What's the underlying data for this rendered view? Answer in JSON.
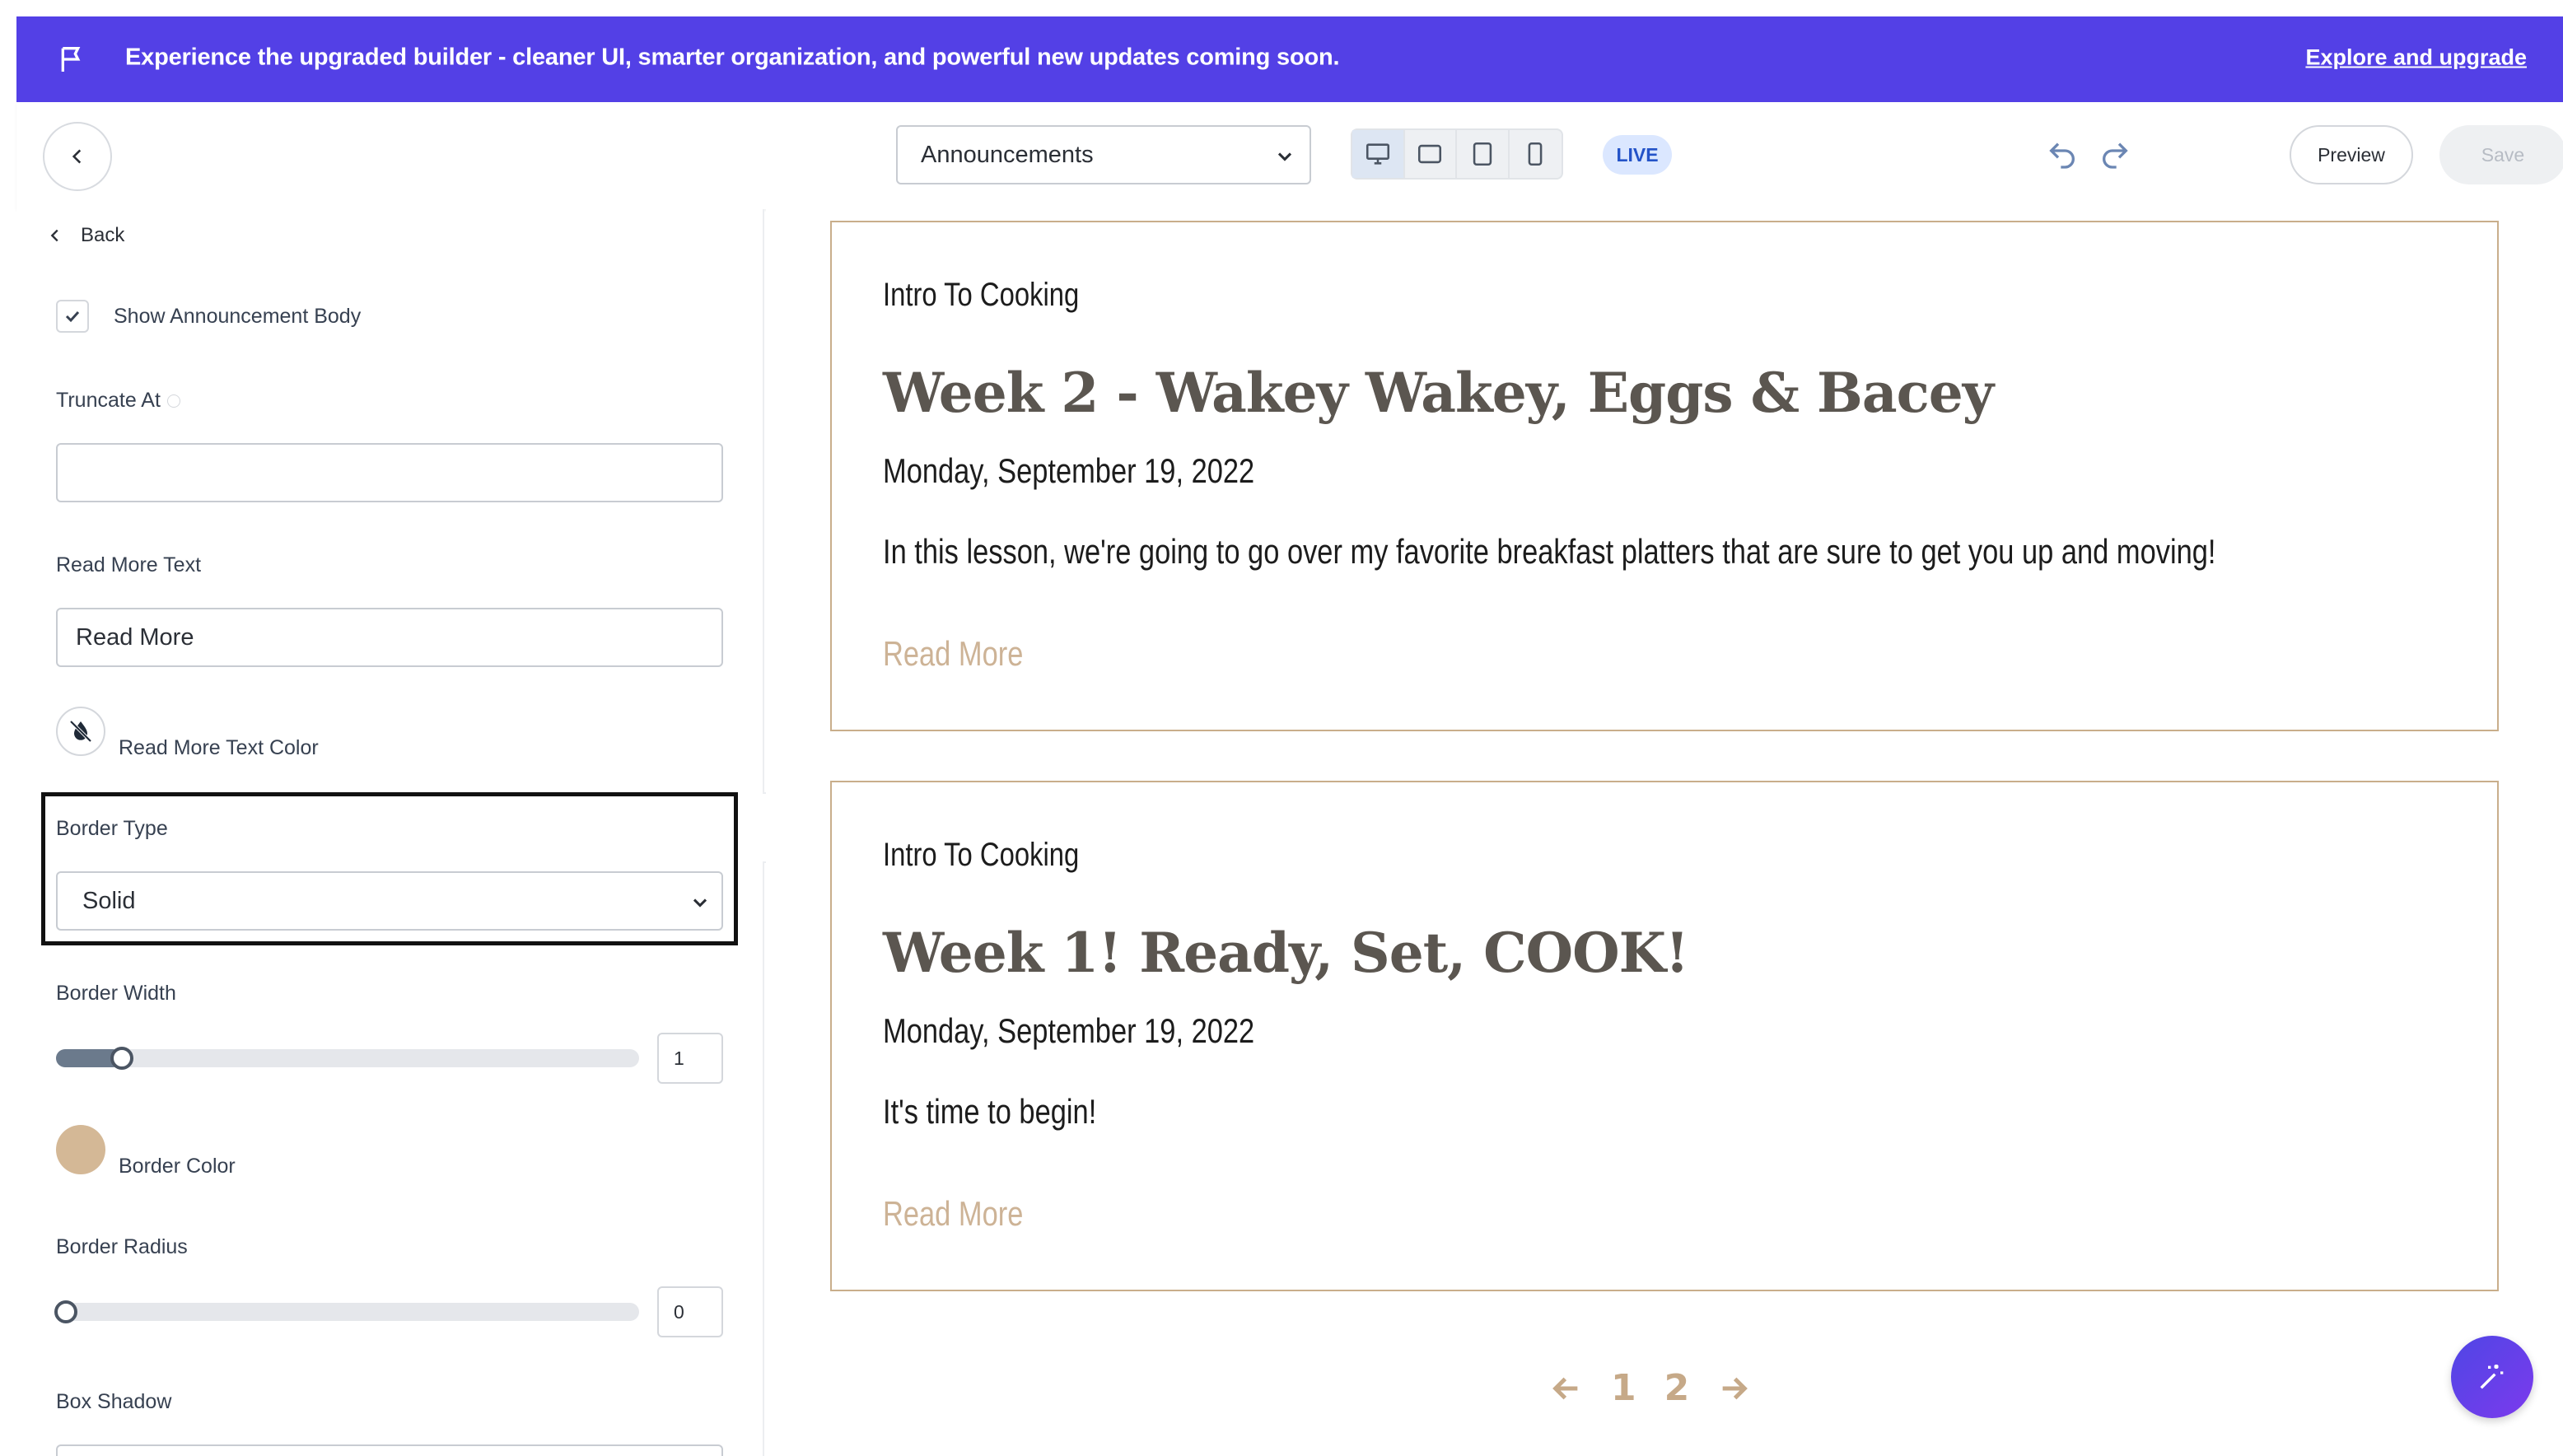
{
  "banner": {
    "text": "Experience the upgraded builder - cleaner UI, smarter organization, and powerful new updates coming soon.",
    "link": "Explore and upgrade",
    "bg_color": "#5340e6"
  },
  "toolbar": {
    "page_select_value": "Announcements",
    "devices": [
      "desktop-icon",
      "tablet-landscape-icon",
      "tablet-icon",
      "mobile-icon"
    ],
    "live_label": "LIVE",
    "preview_label": "Preview",
    "save_label": "Save"
  },
  "panel": {
    "back_label": "Back",
    "show_body_label": "Show Announcement Body",
    "show_body_checked": true,
    "truncate_label": "Truncate At",
    "truncate_value": "",
    "read_more_text_label": "Read More Text",
    "read_more_text_value": "Read More",
    "read_more_color_label": "Read More Text Color",
    "border_type_label": "Border Type",
    "border_type_value": "Solid",
    "border_width_label": "Border Width",
    "border_width_value": "1",
    "border_color_label": "Border Color",
    "border_color": "#d4b896",
    "border_radius_label": "Border Radius",
    "border_radius_value": "0",
    "box_shadow_label": "Box Shadow"
  },
  "announcements": [
    {
      "category": "Intro To Cooking",
      "title": "Week 2 - Wakey Wakey, Eggs & Bacey",
      "date": "Monday, September 19, 2022",
      "body": "In this lesson, we're going to go over my favorite breakfast platters that are sure to get you up and moving!",
      "read_more": "Read More"
    },
    {
      "category": "Intro To Cooking",
      "title": "Week 1! Ready, Set, COOK!",
      "date": "Monday, September 19, 2022",
      "body": "It's time to begin!",
      "read_more": "Read More"
    }
  ],
  "pagination": {
    "pages": [
      "1",
      "2"
    ],
    "prev_icon": "arrow-left-icon",
    "next_icon": "arrow-right-icon"
  },
  "colors": {
    "card_border": "#c9ae8b",
    "read_more": "#cdb396",
    "title": "#5b5650",
    "accent": "#5340e6"
  }
}
